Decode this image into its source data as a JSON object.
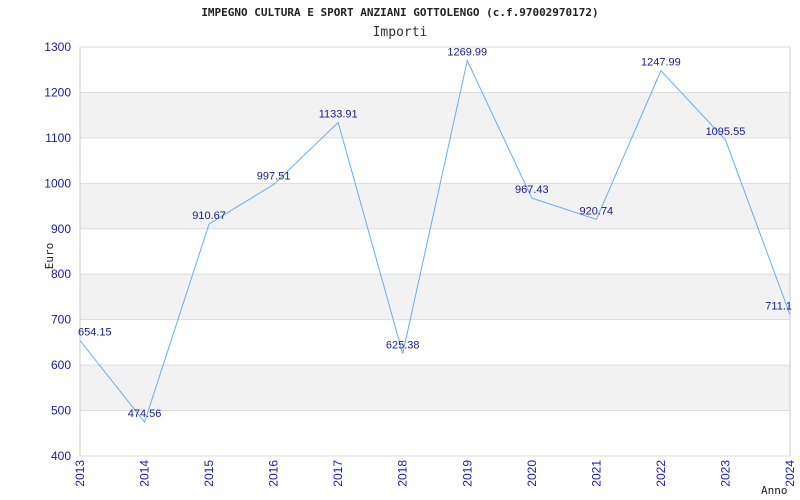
{
  "chart_data": {
    "type": "line",
    "title": "IMPEGNO CULTURA E SPORT ANZIANI GOTTOLENGO (c.f.97002970172)",
    "subtitle": "Importi",
    "xlabel": "Anno",
    "ylabel": "Euro",
    "ylim": [
      400,
      1300
    ],
    "yticks": [
      400,
      500,
      600,
      700,
      800,
      900,
      1000,
      1100,
      1200,
      1300
    ],
    "grid": true,
    "categories": [
      "2013",
      "2014",
      "2015",
      "2016",
      "2017",
      "2018",
      "2019",
      "2020",
      "2021",
      "2022",
      "2023",
      "2024"
    ],
    "series": [
      {
        "values": [
          654.15,
          474.56,
          910.67,
          997.51,
          1133.91,
          625.38,
          1269.99,
          967.43,
          920.74,
          1247.99,
          1095.55,
          711.1
        ],
        "labels": [
          "654.15",
          "474.56",
          "910.67",
          "997.51",
          "1133.91",
          "625.38",
          "1269.99",
          "967.43",
          "920.74",
          "1247.99",
          "1095.55",
          "711.1"
        ],
        "color": "#6aaee8"
      }
    ],
    "band_color": "#f2f2f2",
    "tick_color": "#1a1aa6"
  }
}
